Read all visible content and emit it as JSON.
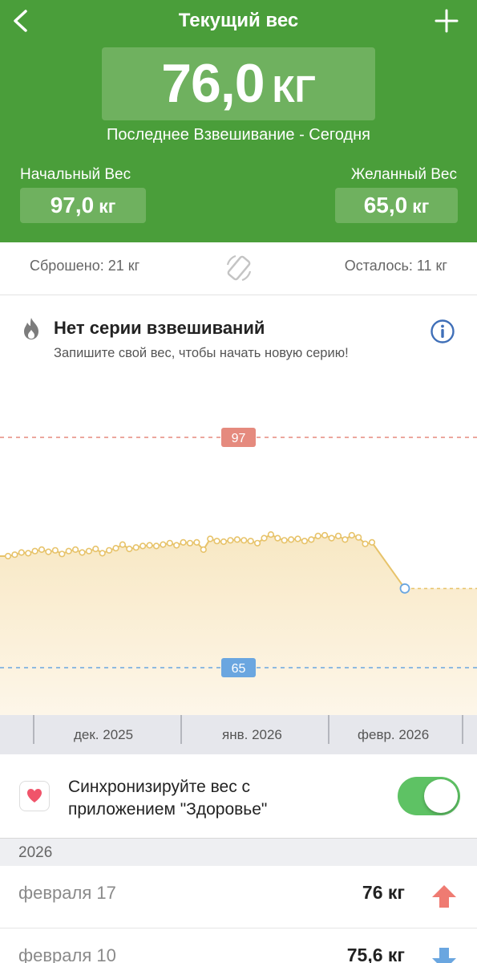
{
  "header": {
    "title": "Текущий вес",
    "current_value": "76,0",
    "current_unit": "КГ",
    "last_weigh": "Последнее Взвешивание - Сегодня",
    "start_label": "Начальный Вес",
    "start_value": "97,0",
    "start_unit": "кг",
    "goal_label": "Желанный Вес",
    "goal_value": "65,0",
    "goal_unit": "кг"
  },
  "stats": {
    "lost": "Сброшено: 21 кг",
    "remaining": "Осталось: 11 кг"
  },
  "streak": {
    "title": "Нет серии взвешиваний",
    "subtitle": "Запишите свой вес, чтобы начать новую серию!"
  },
  "chart_data": {
    "type": "area",
    "start_weight": 97,
    "goal_weight": 65,
    "start_label": "97",
    "goal_label": "65",
    "x_ticks": [
      "дек. 2025",
      "янв. 2026",
      "февр. 2026"
    ],
    "y": [
      80.5,
      80.7,
      81.0,
      80.9,
      81.2,
      81.4,
      81.1,
      81.3,
      80.8,
      81.2,
      81.4,
      81.0,
      81.2,
      81.5,
      80.9,
      81.3,
      81.6,
      82.1,
      81.5,
      81.7,
      81.9,
      82.0,
      81.9,
      82.1,
      82.3,
      82.0,
      82.4,
      82.3,
      82.4,
      81.4,
      82.9,
      82.6,
      82.5,
      82.7,
      82.8,
      82.7,
      82.6,
      82.3,
      83.0,
      83.5,
      83.0,
      82.7,
      82.8,
      82.9,
      82.6,
      82.8,
      83.3,
      83.4,
      83.0,
      83.3,
      82.8,
      83.4,
      83.1,
      82.2,
      82.4
    ],
    "current": 76.0,
    "colors": {
      "line": "#e7c36a",
      "fill": "#f8e8c4",
      "start": "#e58a7e",
      "goal": "#6aa6e0",
      "current_marker": "#6aa6e0"
    }
  },
  "health": {
    "text_line1": "Синхронизируйте вес с",
    "text_line2": "приложением \"Здоровье\"",
    "toggle_on": true,
    "icon": "heart-icon"
  },
  "history": {
    "year": "2026",
    "rows": [
      {
        "date": "февраля 17",
        "weight": "76 кг",
        "trend": "up",
        "color": "#ef7b72"
      },
      {
        "date": "февраля 10",
        "weight": "75,6 кг",
        "trend": "down",
        "color": "#6aa6e0"
      }
    ]
  }
}
